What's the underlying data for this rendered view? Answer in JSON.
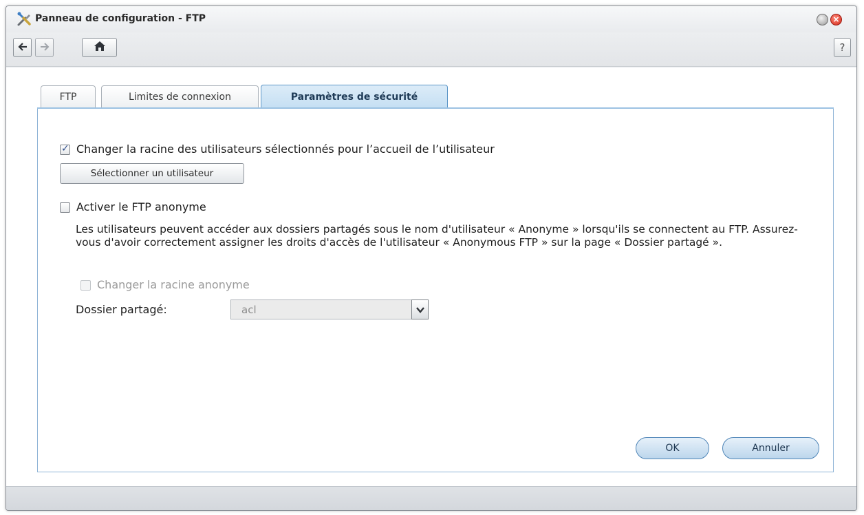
{
  "window": {
    "title": "Panneau de configuration - FTP",
    "app_icon": "tools-icon"
  },
  "toolbar": {
    "back_icon": "arrow-left-icon",
    "forward_icon": "arrow-right-icon",
    "home_icon": "home-icon",
    "help_label": "?"
  },
  "tabs": [
    {
      "label": "FTP",
      "active": false
    },
    {
      "label": "Limites de connexion",
      "active": false
    },
    {
      "label": "Paramètres de sécurité",
      "active": true
    }
  ],
  "security": {
    "change_root_label": "Changer la racine des utilisateurs sélectionnés pour l’accueil de l’utilisateur",
    "change_root_checked": true,
    "select_user_button": "Sélectionner un utilisateur",
    "anonymous_label": "Activer le FTP anonyme",
    "anonymous_checked": false,
    "anonymous_description": "Les utilisateurs peuvent accéder aux dossiers partagés sous le nom d'utilisateur « Anonyme » lorsqu'ils se connectent au FTP. Assurez-vous d'avoir correctement assigner les droits d'accès de l'utilisateur « Anonymous FTP » sur la page « Dossier partagé ».",
    "anonymous_root_label": "Changer la racine anonyme",
    "anonymous_root_checked": false,
    "anonymous_root_disabled": true,
    "shared_folder_label": "Dossier partagé:",
    "shared_folder_value": "acl"
  },
  "actions": {
    "ok_label": "OK",
    "cancel_label": "Annuler"
  },
  "colors": {
    "active_tab": "#c5dff3",
    "accent_border": "#5b95c6",
    "close_button": "#d2281a"
  }
}
